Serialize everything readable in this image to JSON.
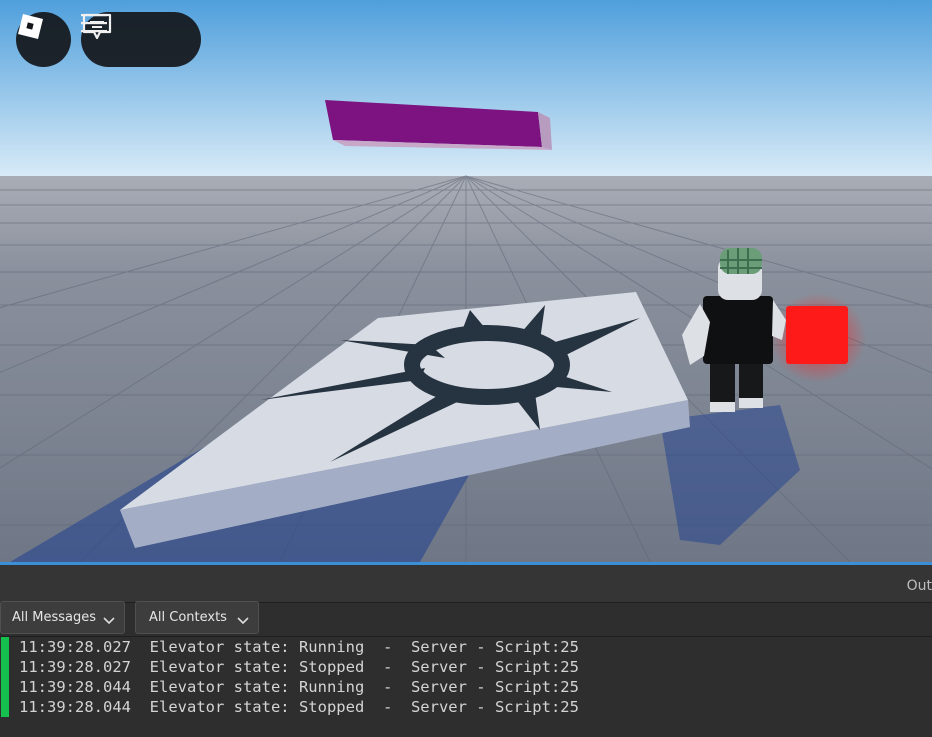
{
  "colors": {
    "sky_top": "#4f9fdc",
    "sky_bottom": "#d9ebf7",
    "ground": "#7c8494",
    "platform": "#d6dae3",
    "magenta_part": "#7d1380",
    "red_part": "#ff1a1a",
    "log_accent": "#16c04e"
  },
  "topbar": {
    "roblox_icon": "roblox-logo-icon",
    "menu_icon": "hamburger-icon",
    "chat_icon": "chat-icon"
  },
  "output": {
    "title": "Out",
    "filters": {
      "messages": "All Messages",
      "contexts": "All Contexts"
    },
    "logs": [
      {
        "time": "11:39:28.027",
        "message": "Elevator state: Running",
        "source": "Server - Script:25"
      },
      {
        "time": "11:39:28.027",
        "message": "Elevator state: Stopped",
        "source": "Server - Script:25"
      },
      {
        "time": "11:39:28.044",
        "message": "Elevator state: Running",
        "source": "Server - Script:25"
      },
      {
        "time": "11:39:28.044",
        "message": "Elevator state: Stopped",
        "source": "Server - Script:25"
      }
    ]
  }
}
